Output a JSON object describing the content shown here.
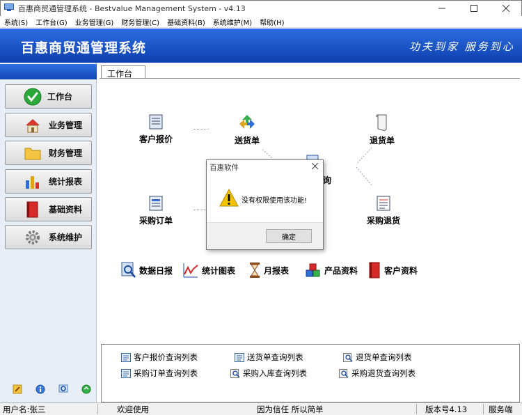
{
  "window": {
    "title": "百惠商贸通管理系统 - Bestvalue Management System - v4.13",
    "controls": [
      "minimize-icon",
      "maximize-icon",
      "close-icon"
    ]
  },
  "menu": [
    {
      "label": "系统(S)"
    },
    {
      "label": "工作台(G)"
    },
    {
      "label": "业务管理(G)"
    },
    {
      "label": "财务管理(C)"
    },
    {
      "label": "基础资料(B)"
    },
    {
      "label": "系统维护(M)"
    },
    {
      "label": "帮助(H)"
    }
  ],
  "banner": {
    "title": "百惠商贸通管理系统",
    "slogan": "功夫到家 服务到心"
  },
  "sidebar": {
    "items": [
      {
        "label": "工作台",
        "icon": "green-check-icon",
        "active": true
      },
      {
        "label": "业务管理",
        "icon": "house-icon"
      },
      {
        "label": "财务管理",
        "icon": "folder-icon"
      },
      {
        "label": "统计报表",
        "icon": "bar-chart-icon"
      },
      {
        "label": "基础资料",
        "icon": "red-book-icon"
      },
      {
        "label": "系统维护",
        "icon": "gear-icon"
      }
    ],
    "tools": [
      "edit-icon",
      "info-icon",
      "search-icon",
      "refresh-icon"
    ]
  },
  "tab": {
    "label": "工作台"
  },
  "flow": {
    "customer_quote": "客户报价",
    "delivery_note": "送货单",
    "return_note": "退货单",
    "purchase_order": "采购订单",
    "purchase_return": "采购退货",
    "query_partial": "询"
  },
  "quick": [
    {
      "label": "数据日报",
      "icon": "magnifier-icon"
    },
    {
      "label": "统计图表",
      "icon": "line-chart-icon"
    },
    {
      "label": "月报表",
      "icon": "hourglass-icon"
    },
    {
      "label": "产品资料",
      "icon": "cubes-icon"
    },
    {
      "label": "客户资料",
      "icon": "red-book-icon"
    }
  ],
  "queries": {
    "row1": [
      {
        "label": "客户报价查询列表",
        "icon": "list-icon"
      },
      {
        "label": "送货单查询列表",
        "icon": "list-icon"
      },
      {
        "label": "退货单查询列表",
        "icon": "search-list-icon"
      }
    ],
    "row2": [
      {
        "label": "采购订单查询列表",
        "icon": "list-icon"
      },
      {
        "label": "采购入库查询列表",
        "icon": "search-list-icon"
      },
      {
        "label": "采购退货查询列表",
        "icon": "search-list-icon"
      }
    ]
  },
  "status": {
    "user": "用户名:张三",
    "welcome": "欢迎使用",
    "motto": "因为信任 所以简单",
    "version": "版本号4.13",
    "mode": "服务端"
  },
  "dialog": {
    "title": "百惠软件",
    "message": "没有权限使用该功能!",
    "ok_label": "确定",
    "icon": "warning-icon"
  },
  "colors": {
    "banner": "#1a52c8",
    "sidebar_bg": "#e8eef7",
    "warning": "#f3c300"
  }
}
